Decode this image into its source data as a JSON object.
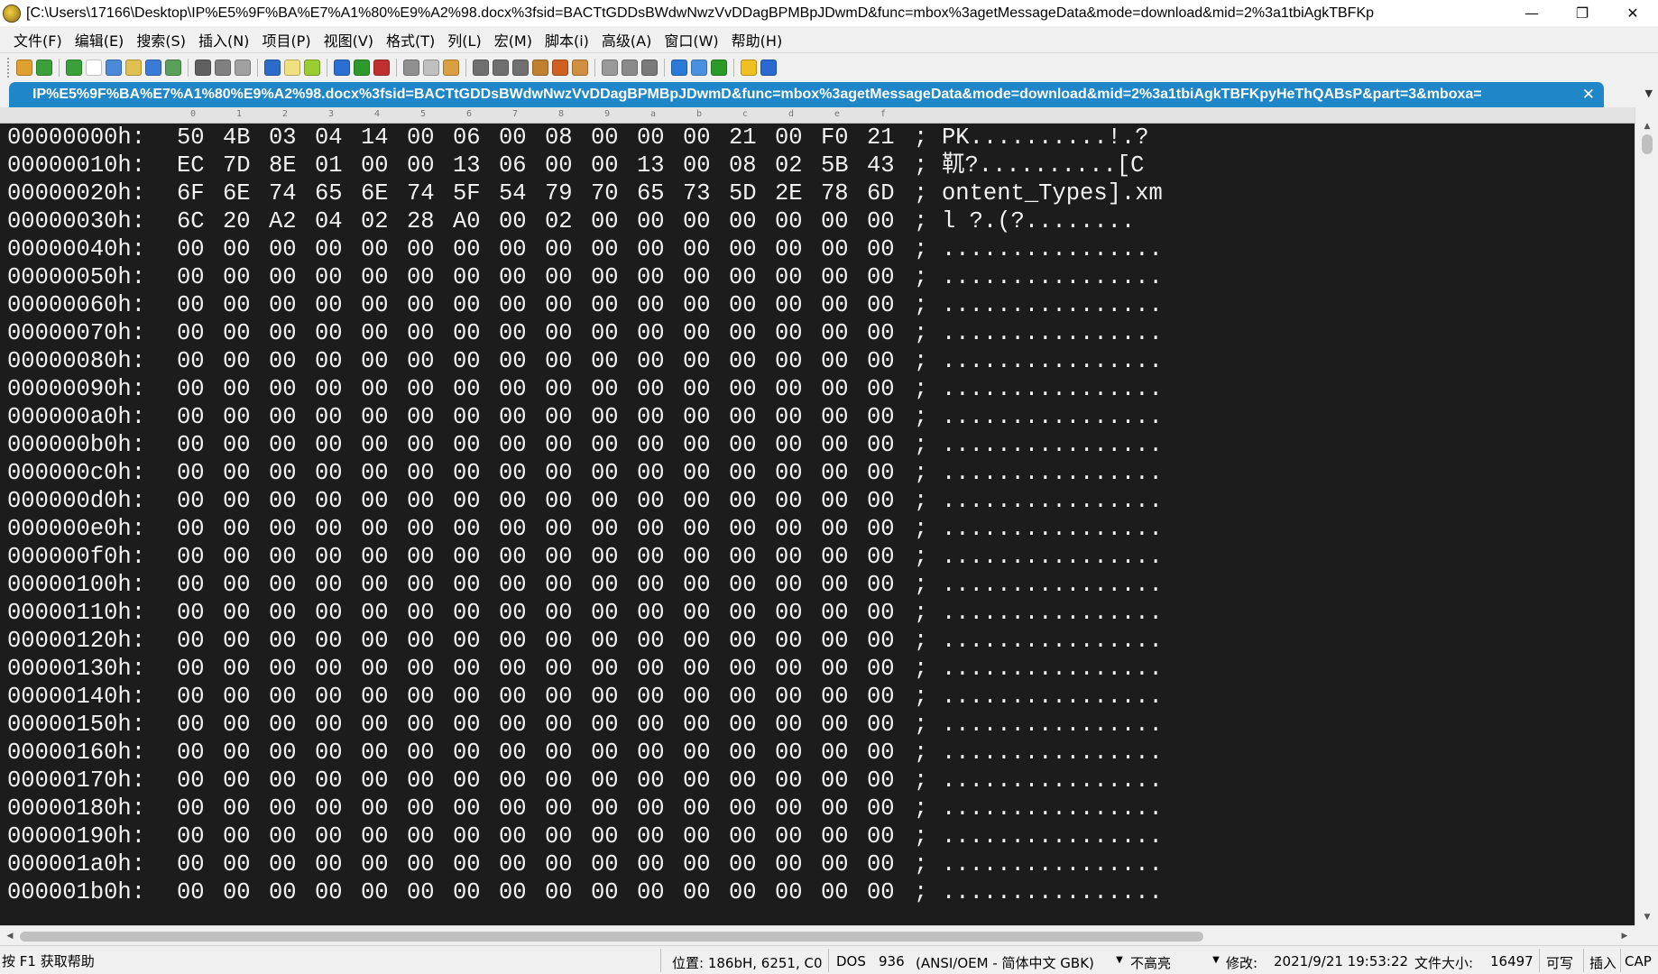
{
  "window": {
    "title": "[C:\\Users\\17166\\Desktop\\IP%E5%9F%BA%E7%A1%80%E9%A2%98.docx%3fsid=BACTtGDDsBWdwNwzVvDDagBPMBpJDwmD&func=mbox%3agetMessageData&mode=download&mid=2%3a1tbiAgkTBFKp",
    "minimize": "—",
    "restore": "❐",
    "close": "✕"
  },
  "menu": [
    "文件(F)",
    "编辑(E)",
    "搜索(S)",
    "插入(N)",
    "项目(P)",
    "视图(V)",
    "格式(T)",
    "列(L)",
    "宏(M)",
    "脚本(i)",
    "高级(A)",
    "窗口(W)",
    "帮助(H)"
  ],
  "toolbar": {
    "icons": [
      "new-file-icon",
      "back-icon",
      "forward-icon",
      "new-icon",
      "open-icon",
      "open-folder-icon",
      "save-icon",
      "save-all-icon",
      "print-icon",
      "print-preview-icon",
      "page-setup-icon",
      "hex-mode-icon",
      "column-mode-icon",
      "word-wrap-icon",
      "ftp-icon",
      "ftp-save-icon",
      "reload-icon",
      "cut-icon",
      "copy-icon",
      "paste-icon",
      "find-icon",
      "find-next-icon",
      "replace-icon",
      "find-in-files-icon",
      "bookmark-icon",
      "bookmark-next-icon",
      "window-tile-icon",
      "window-vertical-icon",
      "window-cascade-icon",
      "browser-icon",
      "screenshot-icon",
      "refresh-icon",
      "tip-icon",
      "help-icon"
    ],
    "colors": [
      "#e0a030",
      "#3aa13a",
      "#3aa13a",
      "#ffffff",
      "#4a8ad8",
      "#e0c050",
      "#3b7ad6",
      "#5aa05a",
      "#606060",
      "#808080",
      "#a0a0a0",
      "#2c6cc8",
      "#f0e080",
      "#9acd32",
      "#2a6fd1",
      "#2e9a2e",
      "#c03030",
      "#909090",
      "#c0c0c0",
      "#d8a040",
      "#707070",
      "#707070",
      "#707070",
      "#c08030",
      "#d06020",
      "#d09040",
      "#9a9a9a",
      "#8a8a8a",
      "#7a7a7a",
      "#2a7ad8",
      "#4a90e0",
      "#2a9a2a",
      "#f0c020",
      "#2a6ad0"
    ]
  },
  "tab": {
    "label": "IP%E5%9F%BA%E7%A1%80%E9%A2%98.docx%3fsid=BACTtGDDsBWdwNwzVvDDagBPMBpJDwmD&func=mbox%3agetMessageData&mode=download&mid=2%3a1tbiAgkTBFKpyHeThQABsP&part=3&mboxa=",
    "close": "✕",
    "scroll": "▼"
  },
  "ruler": [
    "0",
    "1",
    "2",
    "3",
    "4",
    "5",
    "6",
    "7",
    "8",
    "9",
    "a",
    "b",
    "c",
    "d",
    "e",
    "f"
  ],
  "hex_rows": [
    {
      "offset": "00000000h:",
      "bytes": [
        "50",
        "4B",
        "03",
        "04",
        "14",
        "00",
        "06",
        "00",
        "08",
        "00",
        "00",
        "00",
        "21",
        "00",
        "F0",
        "21"
      ],
      "ascii": "PK..........!.?"
    },
    {
      "offset": "00000010h:",
      "bytes": [
        "EC",
        "7D",
        "8E",
        "01",
        "00",
        "00",
        "13",
        "06",
        "00",
        "00",
        "13",
        "00",
        "08",
        "02",
        "5B",
        "43"
      ],
      "ascii": "靰?..........[C"
    },
    {
      "offset": "00000020h:",
      "bytes": [
        "6F",
        "6E",
        "74",
        "65",
        "6E",
        "74",
        "5F",
        "54",
        "79",
        "70",
        "65",
        "73",
        "5D",
        "2E",
        "78",
        "6D"
      ],
      "ascii": "ontent_Types].xm"
    },
    {
      "offset": "00000030h:",
      "bytes": [
        "6C",
        "20",
        "A2",
        "04",
        "02",
        "28",
        "A0",
        "00",
        "02",
        "00",
        "00",
        "00",
        "00",
        "00",
        "00",
        "00"
      ],
      "ascii": "l ?.(?........"
    },
    {
      "offset": "00000040h:",
      "bytes": [
        "00",
        "00",
        "00",
        "00",
        "00",
        "00",
        "00",
        "00",
        "00",
        "00",
        "00",
        "00",
        "00",
        "00",
        "00",
        "00"
      ],
      "ascii": "................"
    },
    {
      "offset": "00000050h:",
      "bytes": [
        "00",
        "00",
        "00",
        "00",
        "00",
        "00",
        "00",
        "00",
        "00",
        "00",
        "00",
        "00",
        "00",
        "00",
        "00",
        "00"
      ],
      "ascii": "................"
    },
    {
      "offset": "00000060h:",
      "bytes": [
        "00",
        "00",
        "00",
        "00",
        "00",
        "00",
        "00",
        "00",
        "00",
        "00",
        "00",
        "00",
        "00",
        "00",
        "00",
        "00"
      ],
      "ascii": "................"
    },
    {
      "offset": "00000070h:",
      "bytes": [
        "00",
        "00",
        "00",
        "00",
        "00",
        "00",
        "00",
        "00",
        "00",
        "00",
        "00",
        "00",
        "00",
        "00",
        "00",
        "00"
      ],
      "ascii": "................"
    },
    {
      "offset": "00000080h:",
      "bytes": [
        "00",
        "00",
        "00",
        "00",
        "00",
        "00",
        "00",
        "00",
        "00",
        "00",
        "00",
        "00",
        "00",
        "00",
        "00",
        "00"
      ],
      "ascii": "................"
    },
    {
      "offset": "00000090h:",
      "bytes": [
        "00",
        "00",
        "00",
        "00",
        "00",
        "00",
        "00",
        "00",
        "00",
        "00",
        "00",
        "00",
        "00",
        "00",
        "00",
        "00"
      ],
      "ascii": "................"
    },
    {
      "offset": "000000a0h:",
      "bytes": [
        "00",
        "00",
        "00",
        "00",
        "00",
        "00",
        "00",
        "00",
        "00",
        "00",
        "00",
        "00",
        "00",
        "00",
        "00",
        "00"
      ],
      "ascii": "................"
    },
    {
      "offset": "000000b0h:",
      "bytes": [
        "00",
        "00",
        "00",
        "00",
        "00",
        "00",
        "00",
        "00",
        "00",
        "00",
        "00",
        "00",
        "00",
        "00",
        "00",
        "00"
      ],
      "ascii": "................"
    },
    {
      "offset": "000000c0h:",
      "bytes": [
        "00",
        "00",
        "00",
        "00",
        "00",
        "00",
        "00",
        "00",
        "00",
        "00",
        "00",
        "00",
        "00",
        "00",
        "00",
        "00"
      ],
      "ascii": "................"
    },
    {
      "offset": "000000d0h:",
      "bytes": [
        "00",
        "00",
        "00",
        "00",
        "00",
        "00",
        "00",
        "00",
        "00",
        "00",
        "00",
        "00",
        "00",
        "00",
        "00",
        "00"
      ],
      "ascii": "................"
    },
    {
      "offset": "000000e0h:",
      "bytes": [
        "00",
        "00",
        "00",
        "00",
        "00",
        "00",
        "00",
        "00",
        "00",
        "00",
        "00",
        "00",
        "00",
        "00",
        "00",
        "00"
      ],
      "ascii": "................"
    },
    {
      "offset": "000000f0h:",
      "bytes": [
        "00",
        "00",
        "00",
        "00",
        "00",
        "00",
        "00",
        "00",
        "00",
        "00",
        "00",
        "00",
        "00",
        "00",
        "00",
        "00"
      ],
      "ascii": "................"
    },
    {
      "offset": "00000100h:",
      "bytes": [
        "00",
        "00",
        "00",
        "00",
        "00",
        "00",
        "00",
        "00",
        "00",
        "00",
        "00",
        "00",
        "00",
        "00",
        "00",
        "00"
      ],
      "ascii": "................"
    },
    {
      "offset": "00000110h:",
      "bytes": [
        "00",
        "00",
        "00",
        "00",
        "00",
        "00",
        "00",
        "00",
        "00",
        "00",
        "00",
        "00",
        "00",
        "00",
        "00",
        "00"
      ],
      "ascii": "................"
    },
    {
      "offset": "00000120h:",
      "bytes": [
        "00",
        "00",
        "00",
        "00",
        "00",
        "00",
        "00",
        "00",
        "00",
        "00",
        "00",
        "00",
        "00",
        "00",
        "00",
        "00"
      ],
      "ascii": "................"
    },
    {
      "offset": "00000130h:",
      "bytes": [
        "00",
        "00",
        "00",
        "00",
        "00",
        "00",
        "00",
        "00",
        "00",
        "00",
        "00",
        "00",
        "00",
        "00",
        "00",
        "00"
      ],
      "ascii": "................"
    },
    {
      "offset": "00000140h:",
      "bytes": [
        "00",
        "00",
        "00",
        "00",
        "00",
        "00",
        "00",
        "00",
        "00",
        "00",
        "00",
        "00",
        "00",
        "00",
        "00",
        "00"
      ],
      "ascii": "................"
    },
    {
      "offset": "00000150h:",
      "bytes": [
        "00",
        "00",
        "00",
        "00",
        "00",
        "00",
        "00",
        "00",
        "00",
        "00",
        "00",
        "00",
        "00",
        "00",
        "00",
        "00"
      ],
      "ascii": "................"
    },
    {
      "offset": "00000160h:",
      "bytes": [
        "00",
        "00",
        "00",
        "00",
        "00",
        "00",
        "00",
        "00",
        "00",
        "00",
        "00",
        "00",
        "00",
        "00",
        "00",
        "00"
      ],
      "ascii": "................"
    },
    {
      "offset": "00000170h:",
      "bytes": [
        "00",
        "00",
        "00",
        "00",
        "00",
        "00",
        "00",
        "00",
        "00",
        "00",
        "00",
        "00",
        "00",
        "00",
        "00",
        "00"
      ],
      "ascii": "................"
    },
    {
      "offset": "00000180h:",
      "bytes": [
        "00",
        "00",
        "00",
        "00",
        "00",
        "00",
        "00",
        "00",
        "00",
        "00",
        "00",
        "00",
        "00",
        "00",
        "00",
        "00"
      ],
      "ascii": "................"
    },
    {
      "offset": "00000190h:",
      "bytes": [
        "00",
        "00",
        "00",
        "00",
        "00",
        "00",
        "00",
        "00",
        "00",
        "00",
        "00",
        "00",
        "00",
        "00",
        "00",
        "00"
      ],
      "ascii": "................"
    },
    {
      "offset": "000001a0h:",
      "bytes": [
        "00",
        "00",
        "00",
        "00",
        "00",
        "00",
        "00",
        "00",
        "00",
        "00",
        "00",
        "00",
        "00",
        "00",
        "00",
        "00"
      ],
      "ascii": "................"
    },
    {
      "offset": "000001b0h:",
      "bytes": [
        "00",
        "00",
        "00",
        "00",
        "00",
        "00",
        "00",
        "00",
        "00",
        "00",
        "00",
        "00",
        "00",
        "00",
        "00",
        "00"
      ],
      "ascii": "................"
    }
  ],
  "separator": ";",
  "scrollbars": {
    "up": "▲",
    "down": "▼",
    "left": "◀",
    "right": "▶"
  },
  "status": {
    "help": "按 F1 获取帮助",
    "position": "位置: 186bH, 6251, C0",
    "line_ending": "DOS",
    "codepage": "936",
    "encoding": "(ANSI/OEM - 简体中文 GBK)",
    "highlight": "不高亮",
    "modified": "修改:",
    "modified_date": "2021/9/21 19:53:22",
    "filesize_label": "文件大小:",
    "filesize": "16497",
    "writable": "可写",
    "insert": "插入",
    "caps": "CAP",
    "dropdown": "▼"
  },
  "colors": {
    "editor_bg": "#1c1c1c",
    "editor_fg": "#f2f2f2",
    "tab_bg": "#1f87c7"
  }
}
